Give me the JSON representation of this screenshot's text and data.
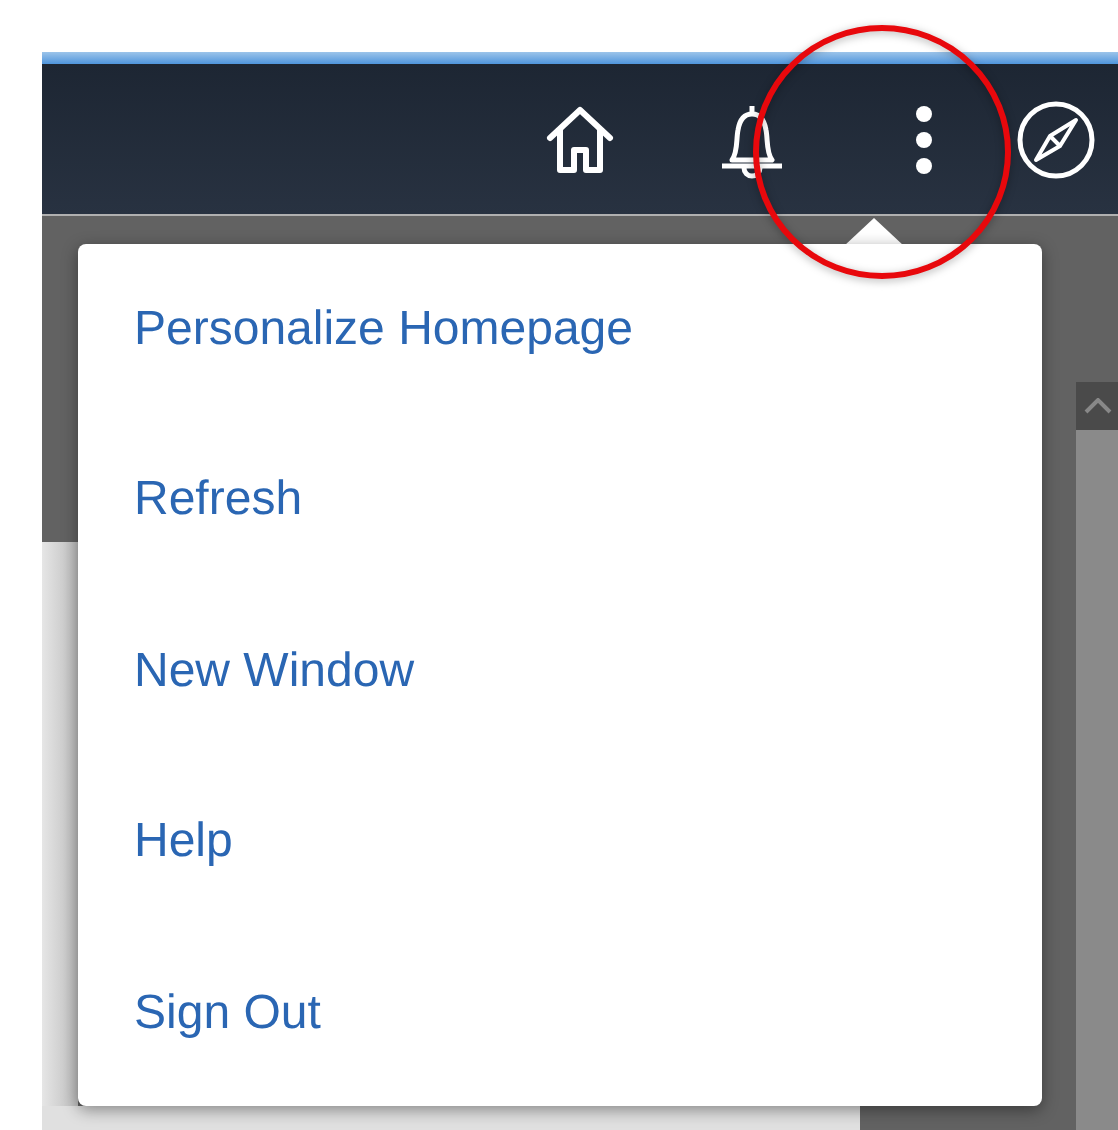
{
  "header": {
    "icons": [
      {
        "kind": "home"
      },
      {
        "kind": "bell"
      },
      {
        "kind": "more"
      },
      {
        "kind": "compass"
      }
    ]
  },
  "menu": {
    "items": [
      {
        "label": "Personalize Homepage"
      },
      {
        "label": "Refresh"
      },
      {
        "label": "New Window"
      },
      {
        "label": "Help"
      },
      {
        "label": "Sign Out"
      }
    ]
  }
}
